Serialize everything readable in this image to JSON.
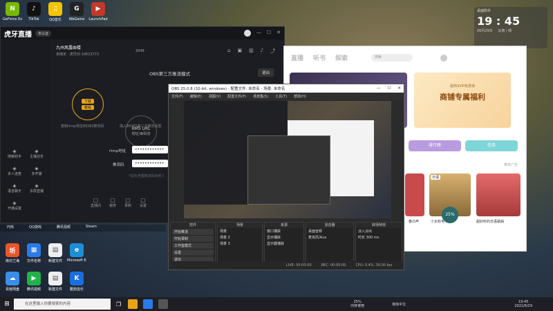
{
  "desktop": {
    "icons_top": [
      {
        "label": "GeForce Experience",
        "color": "#76b900",
        "glyph": "N"
      },
      {
        "label": "TikTok",
        "color": "#111",
        "glyph": "♪"
      },
      {
        "label": "QQ音乐",
        "color": "#f5c400",
        "glyph": "♫"
      },
      {
        "label": "WeGame",
        "color": "#222",
        "glyph": "G"
      },
      {
        "label": "LaunchPad",
        "color": "#c0392b",
        "glyph": "▶"
      }
    ],
    "shelf_labels": [
      "円烁",
      "QQ游戏",
      "腾讯视频",
      "Steam"
    ],
    "icons_bottom_row1": [
      {
        "label": "南日兰海",
        "color": "#e8562a",
        "glyph": "圻"
      },
      {
        "label": "文件名称",
        "color": "#2a7be8",
        "glyph": "▦"
      },
      {
        "label": "新建文件",
        "color": "#eee",
        "glyph": "▤"
      },
      {
        "label": "Microsoft Edge",
        "color": "#1e8fd6",
        "glyph": "e"
      }
    ],
    "icons_bottom_row2": [
      {
        "label": "百度网盘",
        "color": "#3b8ee8",
        "glyph": "☁"
      },
      {
        "label": "腾讯视频",
        "color": "#20b34a",
        "glyph": "▶"
      },
      {
        "label": "新建文件",
        "color": "#eee",
        "glyph": "▤"
      },
      {
        "label": "酷狗音乐",
        "color": "#1a6fe0",
        "glyph": "K"
      }
    ]
  },
  "clock_widget": {
    "header": "桌面助手",
    "time": "19 : 45",
    "date": "06月29日",
    "weather": "云南 | 晴"
  },
  "stream_app": {
    "logo": "虎牙直播",
    "chip": "未认证",
    "user_name": "九州风露由楼",
    "user_meta": "未绑定 · 虎牙ID 10613773",
    "fans": "2049",
    "mode_title": "OBS第三方推流模式",
    "exit_button": "退出",
    "side_items": [
      "搜索助手",
      "主播任务",
      "多人连麦",
      "多开播",
      "语音聊天",
      "多屏直播",
      "开播设置"
    ],
    "step1_btns": [
      "下载",
      "教程"
    ],
    "step1_caption": "复制rtmp地址到OBS推流码",
    "step2_title": "RMS URL",
    "step2_sub": "地址/串码流",
    "step2_caption": "填入到OBS第三方推流设置",
    "rtmp_label": "rtmp地址",
    "rtmp_value": "••••••••••••",
    "key_label": "推流码",
    "key_value": "••••••••••••",
    "hint": "*请勿泄露推流码给他人",
    "bottom_tools": [
      "直播间",
      "装修",
      "录制",
      "设置"
    ]
  },
  "music_app": {
    "tabs": [
      "直播",
      "听书",
      "探索"
    ],
    "search_placeholder": "搜索",
    "vip_title": "商铺专属福利",
    "vip_sub": "最热SVIP免费得",
    "btn_rank": "排行榜",
    "btn_task": "任务",
    "section": "推荐广告",
    "cards": [
      "春の声",
      "少女粉毛",
      "超好听的日语歌曲"
    ],
    "live_badge": "日语",
    "progress": "25%"
  },
  "obs": {
    "title": "OBS 25.0.8 (32-bit, windows) - 配置文件: 未命名 - 场景: 未命名",
    "menu": [
      "文件(F)",
      "编辑(E)",
      "视图(V)",
      "配置文件(P)",
      "场景集(S)",
      "工具(T)",
      "帮助(H)"
    ],
    "docks": [
      {
        "title": "控件",
        "rows": [
          "开始推流",
          "开始录制",
          "工作室模式",
          "设置",
          "退出"
        ]
      },
      {
        "title": "场景",
        "rows": [
          "场景",
          "场景 2",
          "场景 3"
        ]
      },
      {
        "title": "来源",
        "rows": [
          "窗口捕获",
          "显示捕获",
          "显示器捕获"
        ]
      },
      {
        "title": "混音器",
        "rows": [
          "桌面音频",
          "麦克风/Aux"
        ]
      },
      {
        "title": "转场特效",
        "rows": [
          "淡入淡出",
          "时长 300 ms"
        ]
      }
    ],
    "status": [
      "LIVE: 00:00:00",
      "REC: 00:00:00",
      "CPU: 0.4%, 30.00 fps"
    ]
  },
  "taskbar": {
    "search_placeholder": "在这里输入你要搜索的内容",
    "cpu": "25%",
    "cpu_label": "内存使用",
    "lang": "简体中文",
    "time": "19:45",
    "date": "2022/6/29"
  }
}
